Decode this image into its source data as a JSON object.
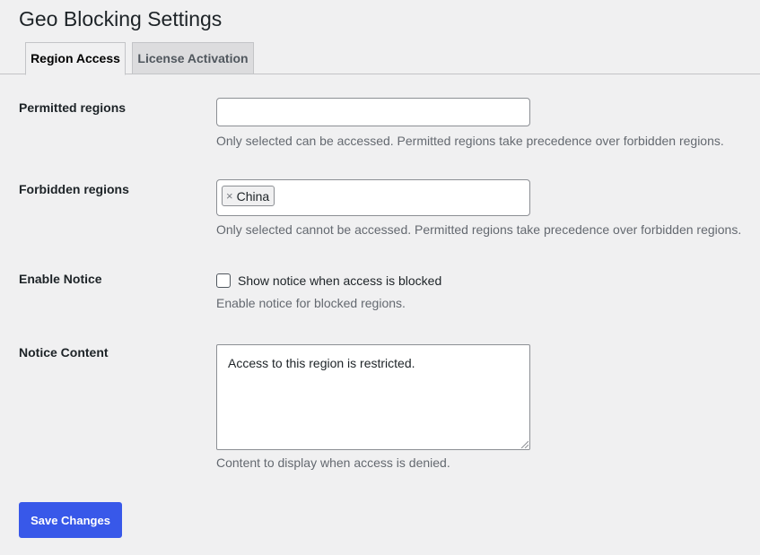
{
  "page": {
    "title": "Geo Blocking Settings"
  },
  "tabs": [
    {
      "label": "Region Access",
      "active": true
    },
    {
      "label": "License Activation",
      "active": false
    }
  ],
  "fields": {
    "permitted": {
      "label": "Permitted regions",
      "value": "",
      "description": "Only selected can be accessed. Permitted regions take precedence over forbidden regions."
    },
    "forbidden": {
      "label": "Forbidden regions",
      "tags": [
        "China"
      ],
      "remove_glyph": "×",
      "description": "Only selected cannot be accessed. Permitted regions take precedence over forbidden regions."
    },
    "notice": {
      "label": "Enable Notice",
      "checkbox_label": "Show notice when access is blocked",
      "checked": false,
      "description": "Enable notice for blocked regions."
    },
    "content": {
      "label": "Notice Content",
      "value": "Access to this region is restricted.",
      "description": "Content to display when access is denied."
    }
  },
  "actions": {
    "save_label": "Save Changes"
  },
  "colors": {
    "background": "#f0f0f1",
    "primary_button": "#3858e9",
    "text": "#1d2327",
    "description": "#646970"
  }
}
